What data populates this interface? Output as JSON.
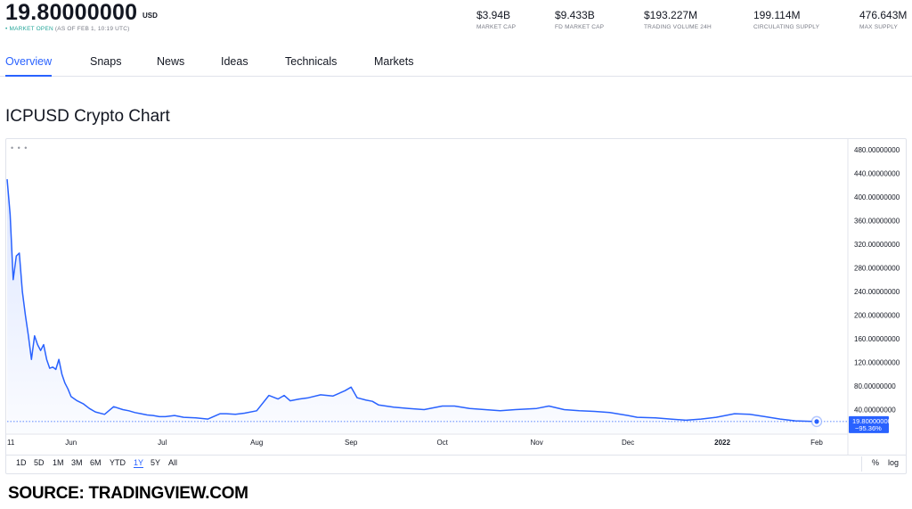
{
  "header": {
    "price": "19.80000000",
    "price_unit": "USD",
    "market_dot": "•",
    "market_open": "MARKET OPEN",
    "market_time": "(AS OF FEB 1, 10:19 UTC)",
    "stats": [
      {
        "value": "$3.94B",
        "label": "MARKET CAP"
      },
      {
        "value": "$9.433B",
        "label": "FD MARKET CAP"
      },
      {
        "value": "$193.227M",
        "label": "TRADING VOLUME 24H"
      },
      {
        "value": "199.114M",
        "label": "CIRCULATING SUPPLY"
      },
      {
        "value": "476.643M",
        "label": "MAX SUPPLY"
      }
    ]
  },
  "tabs": [
    {
      "label": "Overview",
      "active": true
    },
    {
      "label": "Snaps"
    },
    {
      "label": "News"
    },
    {
      "label": "Ideas"
    },
    {
      "label": "Technicals"
    },
    {
      "label": "Markets"
    }
  ],
  "page_title": "ICPUSD Crypto Chart",
  "chart_menu": "• • •",
  "chart_data": {
    "type": "area",
    "x_unit": "date",
    "x": [
      "2021-05-11",
      "2021-05-12",
      "2021-05-13",
      "2021-05-14",
      "2021-05-15",
      "2021-05-16",
      "2021-05-17",
      "2021-05-18",
      "2021-05-19",
      "2021-05-20",
      "2021-05-21",
      "2021-05-22",
      "2021-05-23",
      "2021-05-24",
      "2021-05-25",
      "2021-05-26",
      "2021-05-27",
      "2021-05-28",
      "2021-05-29",
      "2021-05-30",
      "2021-05-31",
      "2021-06-01",
      "2021-06-03",
      "2021-06-05",
      "2021-06-07",
      "2021-06-09",
      "2021-06-12",
      "2021-06-15",
      "2021-06-18",
      "2021-06-20",
      "2021-06-22",
      "2021-06-24",
      "2021-06-26",
      "2021-06-28",
      "2021-06-30",
      "2021-07-02",
      "2021-07-05",
      "2021-07-08",
      "2021-07-12",
      "2021-07-16",
      "2021-07-20",
      "2021-07-22",
      "2021-07-25",
      "2021-07-28",
      "2021-08-01",
      "2021-08-05",
      "2021-08-08",
      "2021-08-10",
      "2021-08-12",
      "2021-08-15",
      "2021-08-18",
      "2021-08-22",
      "2021-08-26",
      "2021-08-30",
      "2021-09-01",
      "2021-09-03",
      "2021-09-06",
      "2021-09-08",
      "2021-09-10",
      "2021-09-15",
      "2021-09-20",
      "2021-09-25",
      "2021-10-01",
      "2021-10-05",
      "2021-10-10",
      "2021-10-15",
      "2021-10-20",
      "2021-10-25",
      "2021-11-01",
      "2021-11-05",
      "2021-11-10",
      "2021-11-15",
      "2021-11-20",
      "2021-11-25",
      "2021-12-01",
      "2021-12-04",
      "2021-12-10",
      "2021-12-15",
      "2021-12-20",
      "2021-12-25",
      "2021-12-30",
      "2022-01-05",
      "2022-01-10",
      "2022-01-15",
      "2022-01-20",
      "2022-01-25",
      "2022-02-01"
    ],
    "y": [
      430,
      370,
      260,
      300,
      305,
      240,
      200,
      165,
      125,
      165,
      150,
      140,
      150,
      125,
      110,
      112,
      108,
      125,
      100,
      85,
      75,
      62,
      55,
      50,
      42,
      36,
      32,
      45,
      40,
      38,
      35,
      33,
      31,
      30,
      28,
      28,
      30,
      27,
      26,
      24,
      33,
      33,
      32,
      34,
      38,
      64,
      58,
      64,
      55,
      58,
      60,
      65,
      63,
      72,
      78,
      60,
      56,
      54,
      48,
      44,
      42,
      40,
      46,
      46,
      42,
      40,
      38,
      40,
      42,
      46,
      40,
      38,
      37,
      35,
      30,
      27,
      26,
      24,
      22,
      24,
      27,
      33,
      32,
      28,
      24,
      21,
      19.8
    ],
    "xticks": [
      {
        "date": "2021-05-11",
        "label": "11"
      },
      {
        "date": "2021-06-01",
        "label": "Jun"
      },
      {
        "date": "2021-07-01",
        "label": "Jul"
      },
      {
        "date": "2021-08-01",
        "label": "Aug"
      },
      {
        "date": "2021-09-01",
        "label": "Sep"
      },
      {
        "date": "2021-10-01",
        "label": "Oct"
      },
      {
        "date": "2021-11-01",
        "label": "Nov"
      },
      {
        "date": "2021-12-01",
        "label": "Dec"
      },
      {
        "date": "2022-01-01",
        "label": "2022"
      },
      {
        "date": "2022-02-01",
        "label": "Feb"
      }
    ],
    "yticks": [
      40,
      80,
      120,
      160,
      200,
      240,
      280,
      320,
      360,
      400,
      440,
      480
    ],
    "ytick_labels": [
      "40.00000000",
      "80.00000000",
      "120.00000000",
      "160.00000000",
      "200.00000000",
      "240.00000000",
      "280.00000000",
      "320.00000000",
      "360.00000000",
      "400.00000000",
      "440.00000000",
      "480.00000000"
    ],
    "ylim": [
      0,
      495
    ],
    "last_value": 19.8,
    "last_value_label": "19.80000000",
    "last_change_label": "−95.36%",
    "line_color": "#2962ff",
    "fill_color": "#2962ff",
    "grid": false,
    "title": "",
    "xlabel": "",
    "ylabel": ""
  },
  "range_buttons": [
    {
      "label": "1D"
    },
    {
      "label": "5D"
    },
    {
      "label": "1M"
    },
    {
      "label": "3M"
    },
    {
      "label": "6M"
    },
    {
      "label": "YTD"
    },
    {
      "label": "1Y",
      "active": true
    },
    {
      "label": "5Y"
    },
    {
      "label": "All"
    }
  ],
  "scale_buttons": [
    {
      "label": "%"
    },
    {
      "label": "log"
    }
  ],
  "source_caption": "SOURCE: TRADINGVIEW.COM"
}
